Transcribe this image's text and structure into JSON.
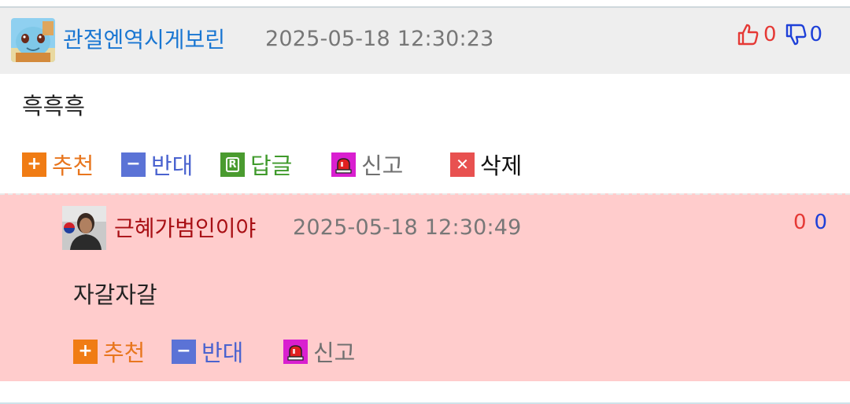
{
  "comment": {
    "author": "관절엔역시게보린",
    "timestamp": "2025-05-18 12:30:23",
    "upvotes": "0",
    "downvotes": "0",
    "body": "흑흑흑",
    "actions": {
      "recommend": "추천",
      "oppose": "반대",
      "reply": "답글",
      "report": "신고",
      "delete": "삭제"
    }
  },
  "reply": {
    "author": "근혜가범인이야",
    "timestamp": "2025-05-18 12:30:49",
    "upvotes": "0",
    "downvotes": "0",
    "body": "자갈자갈",
    "actions": {
      "recommend": "추천",
      "oppose": "반대",
      "report": "신고"
    }
  },
  "colors": {
    "author_link": "#1976d2",
    "reply_author": "#a80f14",
    "reply_background": "#ffcccc",
    "header_background": "#eeeeee",
    "recommend": "#f07c14",
    "oppose": "#5b73d6",
    "reply_action": "#4a9b2f",
    "report": "#d91fd0",
    "delete": "#e85150"
  },
  "icons": {
    "thumbs_up": "thumbs-up-icon",
    "thumbs_down": "thumbs-down-icon",
    "recommend": "plus-icon",
    "oppose": "minus-icon",
    "reply": "reply-r-icon",
    "report": "siren-icon",
    "delete": "x-icon"
  }
}
